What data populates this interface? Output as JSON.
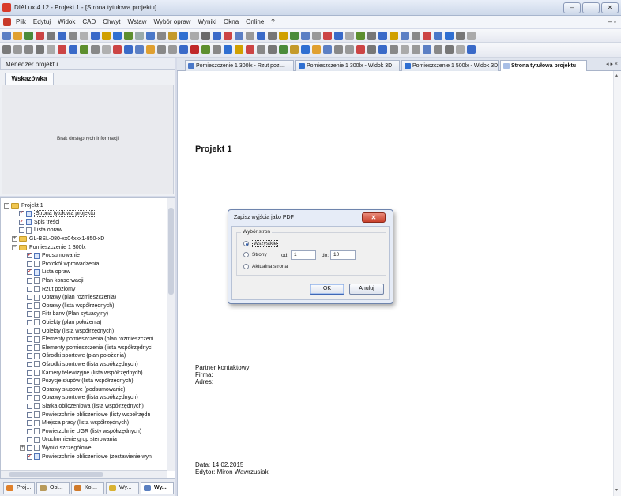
{
  "window": {
    "title": "DIALux 4.12 - Projekt 1 - [Strona tytułowa projektu]",
    "controls": [
      "–",
      "□",
      "✕"
    ]
  },
  "menubar": {
    "items": [
      "Plik",
      "Edytuj",
      "Widok",
      "CAD",
      "Chwyt",
      "Wstaw",
      "Wybór opraw",
      "Wyniki",
      "Okna",
      "Online",
      "?"
    ],
    "close_glyph": "– ▫"
  },
  "colors": {
    "accent": "#2d5aa8",
    "checked": "#c0282a",
    "folder": "#f0c650"
  },
  "left_panel": {
    "header": "Menedżer projektu",
    "hint_tab": "Wskazówka",
    "hint_text": "Brak dostępnych informacji"
  },
  "tree": [
    {
      "label": "Projekt 1",
      "level": 0,
      "kind": "folder",
      "expander": "−"
    },
    {
      "label": "Strona tytułowa projektu",
      "level": 1,
      "kind": "doc",
      "checked": true,
      "selected": true
    },
    {
      "label": "Spis treści",
      "level": 1,
      "kind": "doc",
      "checked": true
    },
    {
      "label": "Lista opraw",
      "level": 1,
      "kind": "doc",
      "checked": false
    },
    {
      "label": "GL-BSL-080-xx04xxx1-850-xD",
      "level": 1,
      "kind": "folder",
      "expander": "+"
    },
    {
      "label": "Pomieszczenie 1 300lx",
      "level": 1,
      "kind": "folder",
      "expander": "−"
    },
    {
      "label": "Podsumowanie",
      "level": 2,
      "kind": "doc",
      "checked": true
    },
    {
      "label": "Protokół wprowadzenia",
      "level": 2,
      "kind": "doc",
      "checked": false
    },
    {
      "label": "Lista opraw",
      "level": 2,
      "kind": "doc",
      "checked": true
    },
    {
      "label": "Plan konserwacji",
      "level": 2,
      "kind": "doc",
      "checked": false
    },
    {
      "label": "Rzut poziomy",
      "level": 2,
      "kind": "doc",
      "checked": false
    },
    {
      "label": "Oprawy (plan rozmieszczenia)",
      "level": 2,
      "kind": "doc",
      "checked": false
    },
    {
      "label": "Oprawy (lista współrzędnych)",
      "level": 2,
      "kind": "doc",
      "checked": false
    },
    {
      "label": "Filtr barw (Plan sytuacyjny)",
      "level": 2,
      "kind": "doc",
      "checked": false
    },
    {
      "label": "Obiekty (plan położenia)",
      "level": 2,
      "kind": "doc",
      "checked": false
    },
    {
      "label": "Obiekty (lista współrzędnych)",
      "level": 2,
      "kind": "doc",
      "checked": false
    },
    {
      "label": "Elementy pomieszczenia (plan rozmieszczeni",
      "level": 2,
      "kind": "doc",
      "checked": false
    },
    {
      "label": "Elementy pomieszczenia (lista współrzędnycl",
      "level": 2,
      "kind": "doc",
      "checked": false
    },
    {
      "label": "Ośrodki sportowe (plan położenia)",
      "level": 2,
      "kind": "doc",
      "checked": false
    },
    {
      "label": "Ośrodki sportowe (lista współrzędnych)",
      "level": 2,
      "kind": "doc",
      "checked": false
    },
    {
      "label": "Kamery telewizyjne (lista współrzędnych)",
      "level": 2,
      "kind": "doc",
      "checked": false
    },
    {
      "label": "Pozycje słupów (lista współrzędnych)",
      "level": 2,
      "kind": "doc",
      "checked": false
    },
    {
      "label": "Oprawy słupowe (podsumowanie)",
      "level": 2,
      "kind": "doc",
      "checked": false
    },
    {
      "label": "Oprawy sportowe (lista współrzędnych)",
      "level": 2,
      "kind": "doc",
      "checked": false
    },
    {
      "label": "Siatka obliczeniowa (lista współrzędnych)",
      "level": 2,
      "kind": "doc",
      "checked": false
    },
    {
      "label": "Powierzchnie obliczeniowe (listy współrzędn",
      "level": 2,
      "kind": "doc",
      "checked": false
    },
    {
      "label": "Miejsca pracy (lista współrzędnych)",
      "level": 2,
      "kind": "doc",
      "checked": false
    },
    {
      "label": "Powierzchnie UGR (listy współrzędnych)",
      "level": 2,
      "kind": "doc",
      "checked": false
    },
    {
      "label": "Uruchomienie grup sterowania",
      "level": 2,
      "kind": "doc",
      "checked": false
    },
    {
      "label": "Wyniki szczegółowe",
      "level": 2,
      "kind": "doc",
      "checked": false,
      "expander": "+"
    },
    {
      "label": "Powierzchnie obliczeniowe (zestawienie wyn",
      "level": 2,
      "kind": "doc",
      "checked": true
    }
  ],
  "bottom_tabs": [
    "Proj...",
    "Obi...",
    "Kol...",
    "Wy...",
    "Wy..."
  ],
  "doc_tabs": [
    "Pomieszczenie 1 300lx - Rzut pozi...",
    "Pomieszczenie 1 300lx - Widok 3D",
    "Pomieszczenie 1 500lx - Widok 3D",
    "Strona tytułowa projektu"
  ],
  "tab_arrows": "◂ ▸ ×",
  "document": {
    "title": "Projekt 1",
    "contact_lines": [
      "Partner kontaktowy:",
      "Firma:",
      "Adres:"
    ],
    "date_line": "Data: 14.02.2015",
    "editor_line": "Edytor: Miron Wawrzusiak"
  },
  "dialog": {
    "title": "Zapisz wyjścia jako PDF",
    "close": "✕",
    "group_label": "Wybór stron",
    "options": [
      "Wszystkie",
      "Strony",
      "Aktualna strona"
    ],
    "selected": "Wszystkie",
    "from_label": "od:",
    "from_value": "1",
    "to_label": "do:",
    "to_value": "10",
    "ok": "OK",
    "cancel": "Anuluj"
  }
}
